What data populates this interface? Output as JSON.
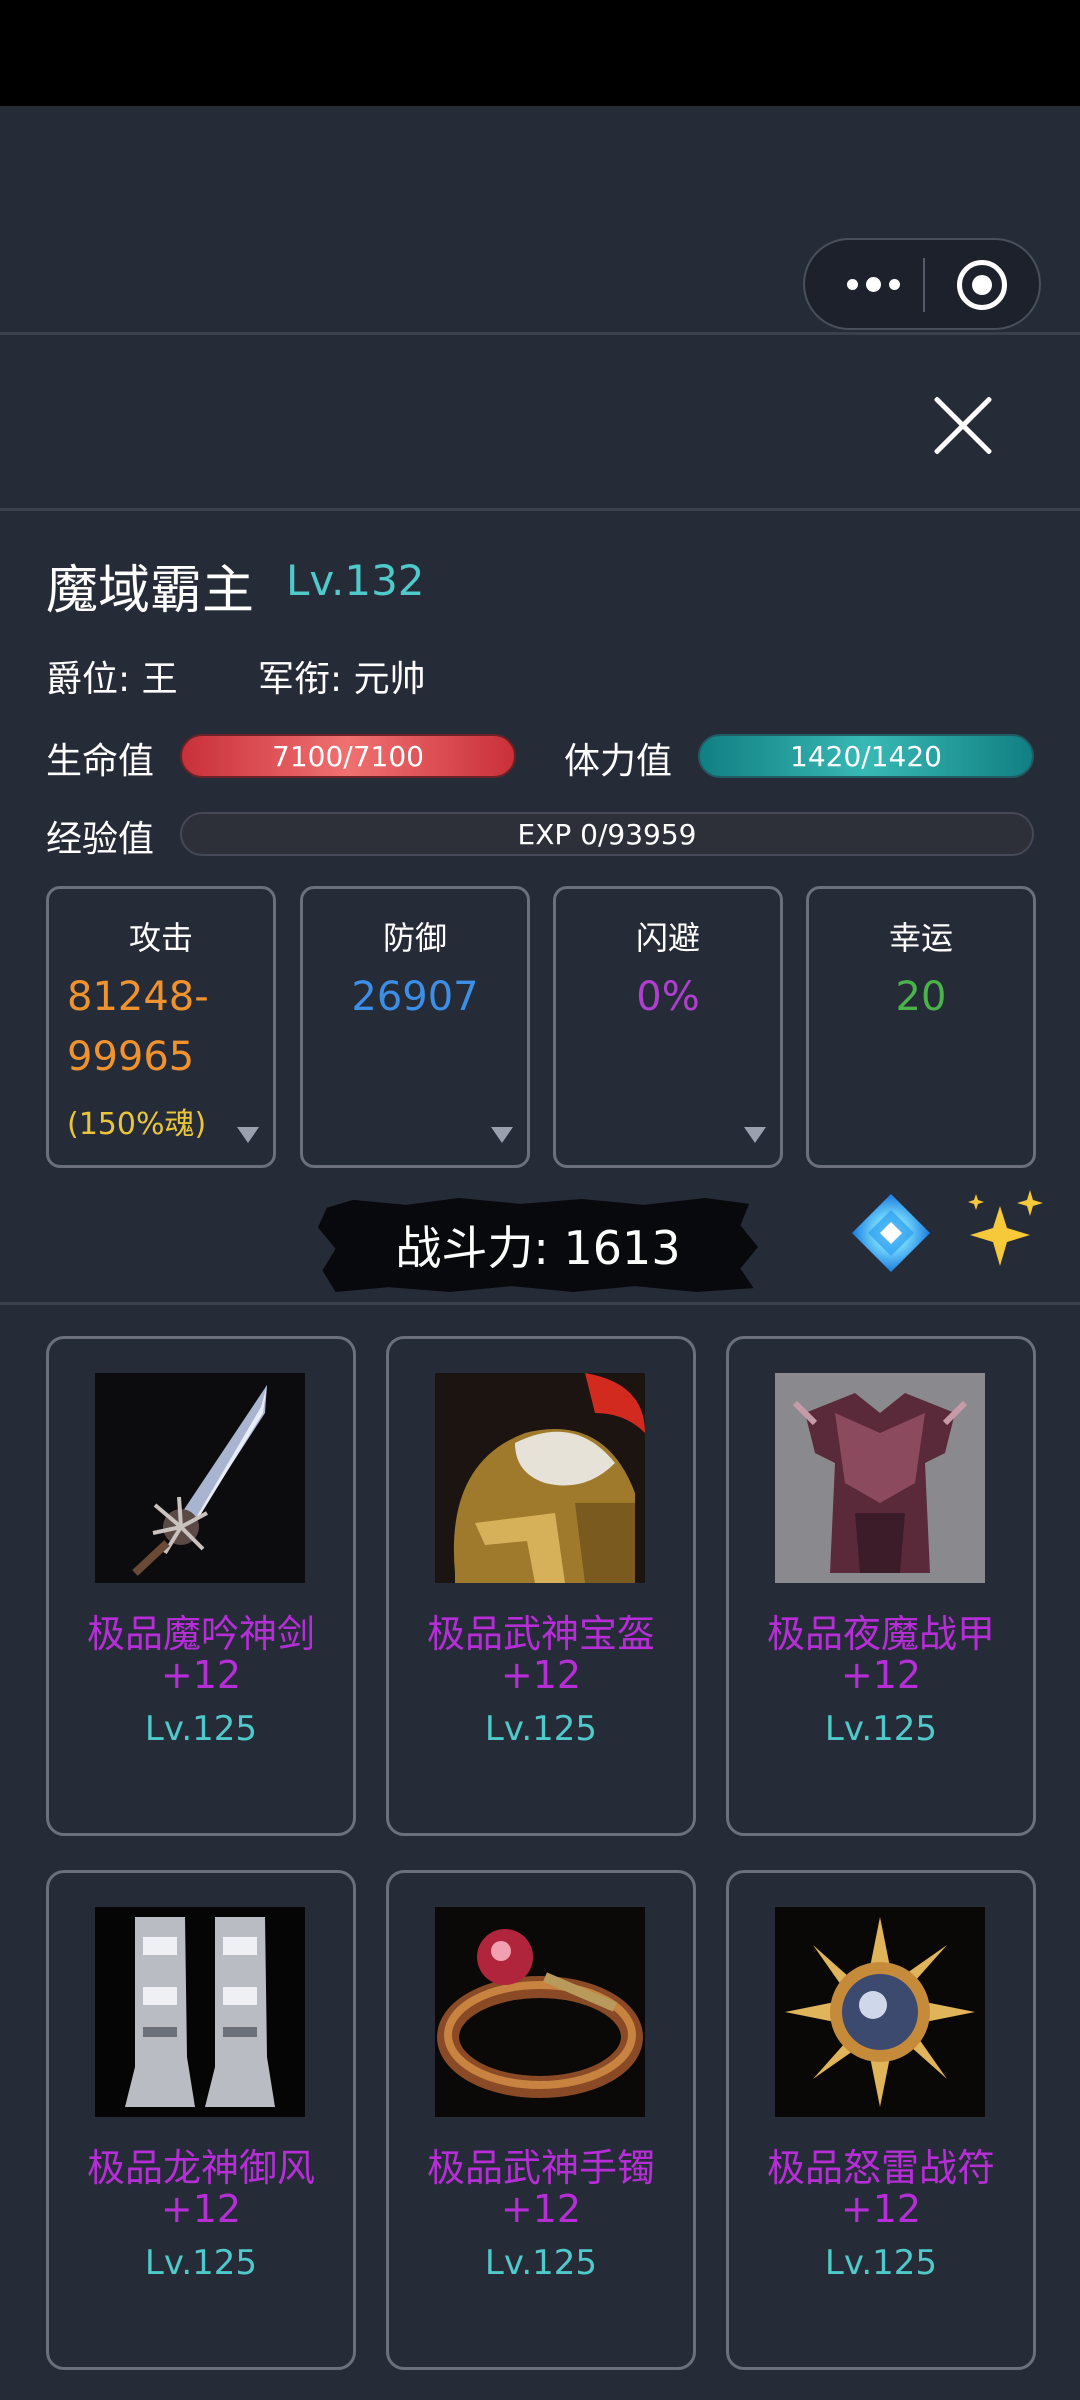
{
  "nav": {
    "more_icon": "more-dots-icon",
    "target_icon": "target-circle-icon",
    "close_icon": "close-icon"
  },
  "profile": {
    "name": "魔域霸主",
    "level": "Lv.132",
    "rank": "爵位: 王",
    "military_title": "军衔: 元帅"
  },
  "bars": {
    "hp_label": "生命值",
    "hp_value": "7100/7100",
    "sp_label": "体力值",
    "sp_value": "1420/1420",
    "exp_label": "经验值",
    "exp_value": "EXP 0/93959"
  },
  "stats": [
    {
      "name": "攻击",
      "value_line1": "81248-",
      "value_line2": "99965",
      "sub": "(150%魂)",
      "color": "#f0922e"
    },
    {
      "name": "防御",
      "value": "26907",
      "color": "#3c8ee6"
    },
    {
      "name": "闪避",
      "value": "0%",
      "color": "#b03fd0"
    },
    {
      "name": "幸运",
      "value": "20",
      "color": "#4ab34a"
    }
  ],
  "power": {
    "text": "战斗力:  1613",
    "gem_icon": "blue-gem-icon",
    "sparkle_icon": "sparkles-icon"
  },
  "equipment": [
    {
      "name": "极品魔吟神剑",
      "plus": "+12",
      "level": "Lv.125",
      "icon": "sword-icon"
    },
    {
      "name": "极品武神宝盔",
      "plus": "+12",
      "level": "Lv.125",
      "icon": "helmet-icon"
    },
    {
      "name": "极品夜魔战甲",
      "plus": "+12",
      "level": "Lv.125",
      "icon": "armor-icon"
    },
    {
      "name": "极品龙神御风",
      "plus": "+12",
      "level": "Lv.125",
      "icon": "boots-icon"
    },
    {
      "name": "极品武神手镯",
      "plus": "+12",
      "level": "Lv.125",
      "icon": "bracelet-icon"
    },
    {
      "name": "极品怒雷战符",
      "plus": "+12",
      "level": "Lv.125",
      "icon": "amulet-icon"
    }
  ]
}
